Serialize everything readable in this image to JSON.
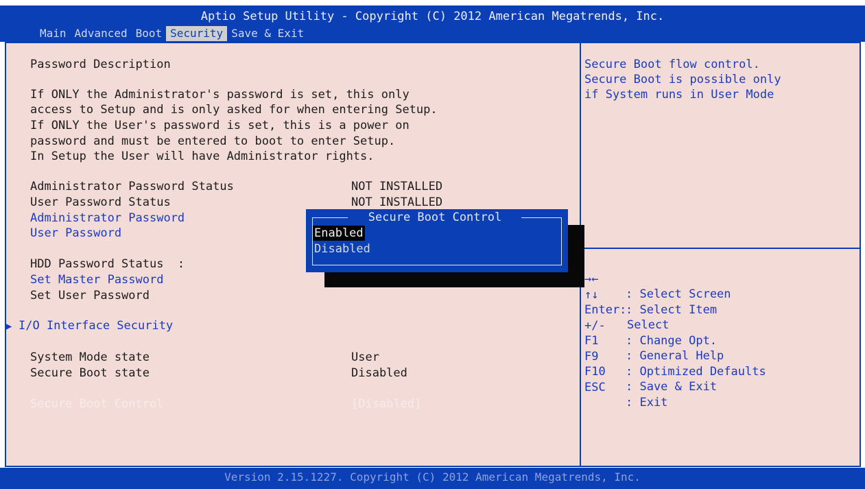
{
  "header": {
    "title": "Aptio Setup Utility - Copyright (C) 2012 American Megatrends, Inc.",
    "tabs": [
      "Main",
      "Advanced",
      "Boot",
      "Security",
      "Save & Exit"
    ],
    "active_tab": "Security"
  },
  "main": {
    "password_description_title": "Password Description",
    "description_lines": [
      "If ONLY the Administrator's password is set, this only",
      "access to Setup and is only asked for when entering Setup.",
      "If ONLY the User's password is set, this is a power on",
      "password and must be entered to boot to enter Setup.",
      "In Setup the User will have Administrator rights."
    ],
    "admin_password_status_label": "Administrator Password Status",
    "admin_password_status_value": "NOT INSTALLED",
    "user_password_status_label": "User Password Status",
    "user_password_status_value": "NOT INSTALLED",
    "administrator_password": "Administrator Password",
    "user_password": "User Password",
    "hdd_password_status_label": "HDD Password Status  :",
    "set_master_password": "Set Master Password",
    "set_user_password": "Set User Password",
    "io_interface_security": "I/O Interface Security",
    "system_mode_state_label": "System Mode state",
    "system_mode_state_value": "User",
    "secure_boot_state_label": "Secure Boot state",
    "secure_boot_state_value": "Disabled",
    "secure_boot_control_label": "Secure Boot Control",
    "secure_boot_control_value": "[Disabled]"
  },
  "popup": {
    "title": "Secure Boot Control",
    "options": [
      "Enabled",
      "Disabled"
    ],
    "selected": "Enabled"
  },
  "help": {
    "lines": [
      "Secure Boot flow control.",
      "Secure Boot is possible only",
      "if System runs in User Mode"
    ]
  },
  "keys": [
    {
      "key": "→←",
      "desc": ": Select Screen"
    },
    {
      "key": "↑↓",
      "desc": ": Select Item"
    },
    {
      "key": "Enter:",
      "desc": "Select"
    },
    {
      "key": "+/-",
      "desc": ": Change Opt."
    },
    {
      "key": "F1",
      "desc": ": General Help"
    },
    {
      "key": "F9",
      "desc": ": Optimized Defaults"
    },
    {
      "key": "F10",
      "desc": ": Save & Exit"
    },
    {
      "key": "ESC",
      "desc": ": Exit"
    }
  ],
  "footer": {
    "version": "Version 2.15.1227. Copyright (C) 2012 American Megatrends, Inc."
  },
  "colors": {
    "bar_blue": "#0a3fb6",
    "panel_bg": "#f3dcd8",
    "link_blue": "#1b3bbf"
  }
}
